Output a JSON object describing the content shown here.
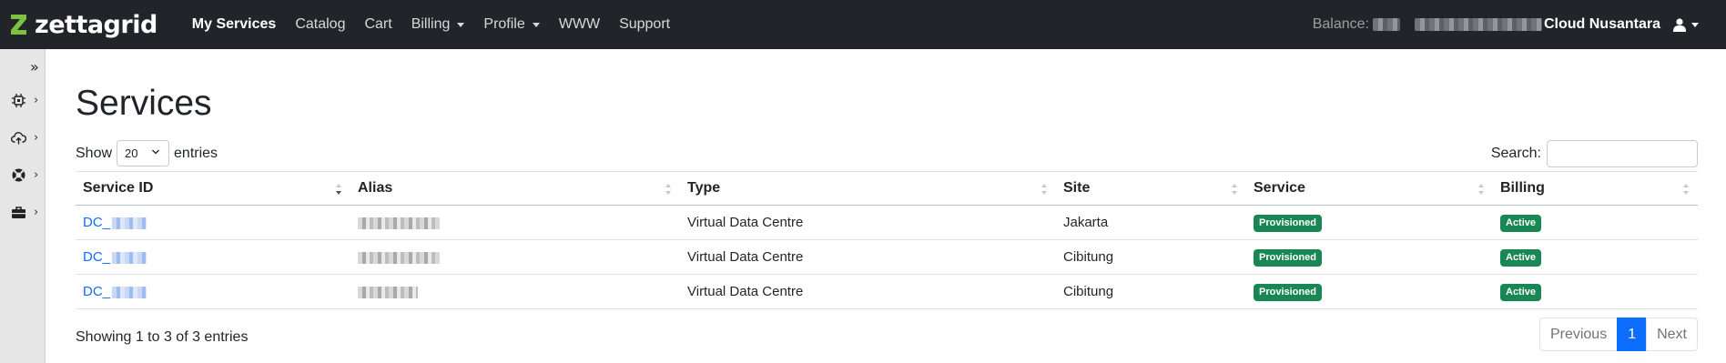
{
  "navbar": {
    "brand": "zettagrid",
    "brand_color": "#7cc142",
    "links": [
      {
        "label": "My Services",
        "active": true,
        "dropdown": false
      },
      {
        "label": "Catalog",
        "active": false,
        "dropdown": false
      },
      {
        "label": "Cart",
        "active": false,
        "dropdown": false
      },
      {
        "label": "Billing",
        "active": false,
        "dropdown": true
      },
      {
        "label": "Profile",
        "active": false,
        "dropdown": true
      },
      {
        "label": "WWW",
        "active": false,
        "dropdown": false
      },
      {
        "label": "Support",
        "active": false,
        "dropdown": false
      }
    ],
    "balance_label": "Balance:",
    "account_name": "Cloud Nusantara",
    "user_icon": "user-icon"
  },
  "sidebar": {
    "toggle_glyph": "»",
    "items": [
      {
        "icon": "chip-icon",
        "chevron": "›"
      },
      {
        "icon": "cloud-upload-icon",
        "chevron": "›"
      },
      {
        "icon": "lifebuoy-icon",
        "chevron": "›"
      },
      {
        "icon": "briefcase-icon",
        "chevron": "›"
      }
    ]
  },
  "page": {
    "title": "Services",
    "show_label": "Show",
    "entries_label": "entries",
    "page_length": "20",
    "search_label": "Search:",
    "search_value": ""
  },
  "table": {
    "headers": [
      "Service ID",
      "Alias",
      "Type",
      "Site",
      "Service",
      "Billing"
    ],
    "rows": [
      {
        "service_id": "DC_",
        "type": "Virtual Data Centre",
        "site": "Jakarta",
        "service": "Provisioned",
        "billing": "Active"
      },
      {
        "service_id": "DC_",
        "type": "Virtual Data Centre",
        "site": "Cibitung",
        "service": "Provisioned",
        "billing": "Active"
      },
      {
        "service_id": "DC_",
        "type": "Virtual Data Centre",
        "site": "Cibitung",
        "service": "Provisioned",
        "billing": "Active"
      }
    ]
  },
  "footer": {
    "info": "Showing 1 to 3 of 3 entries",
    "pagination": {
      "previous": "Previous",
      "current": "1",
      "next": "Next"
    }
  },
  "colors": {
    "navbar_bg": "#212529",
    "link": "#0d6efd",
    "badge_success": "#198754",
    "pagination_active": "#0d6efd"
  }
}
